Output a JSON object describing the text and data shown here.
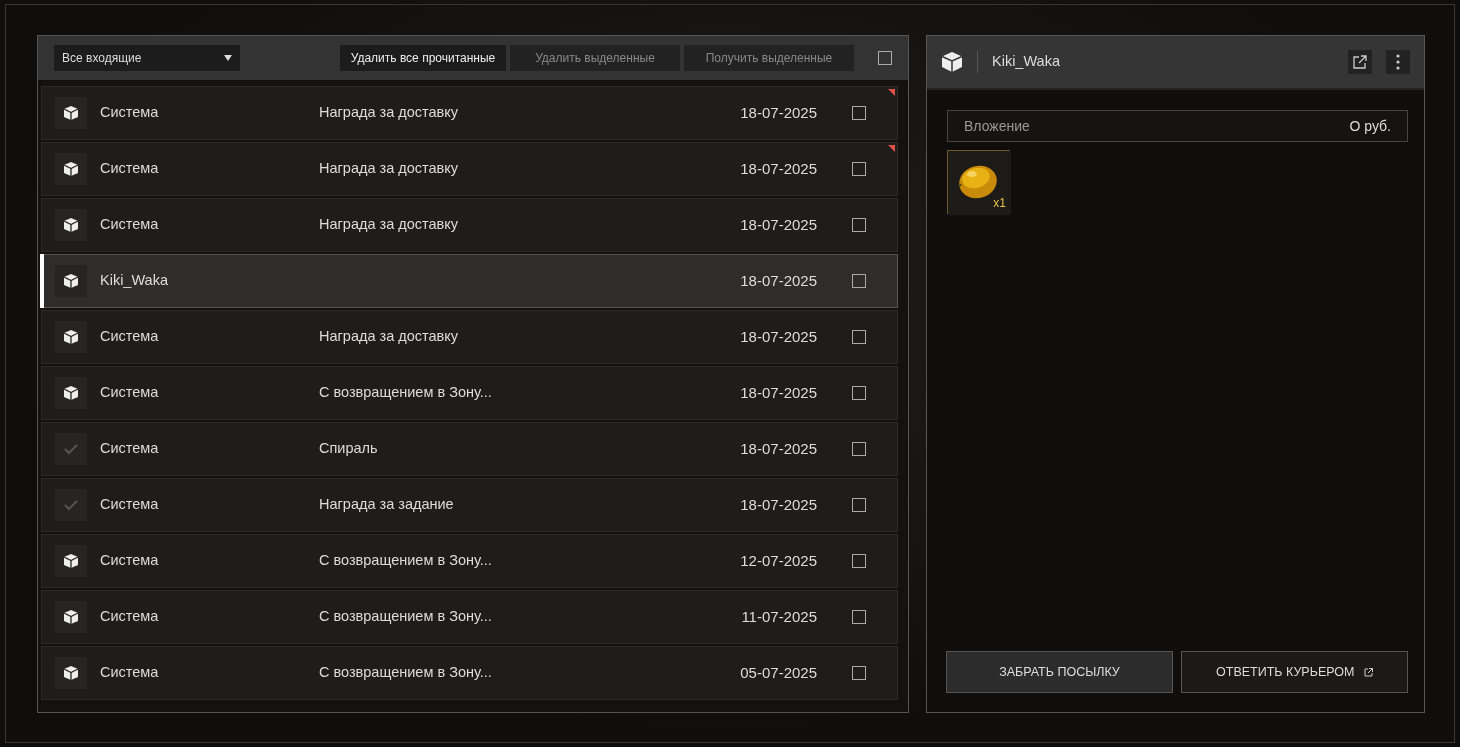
{
  "toolbar": {
    "filter": "Все входящие",
    "buttons": [
      {
        "label": "Удалить все прочитанные",
        "disabled": false
      },
      {
        "label": "Удалить выделенные",
        "disabled": true
      },
      {
        "label": "Получить выделенные",
        "disabled": true
      }
    ],
    "select_all": {
      "checked": false
    }
  },
  "messages": [
    {
      "kind": "parcel",
      "sender": "Система",
      "subject": "Награда за доставку",
      "date": "18-07-2025",
      "unread": true,
      "selected": false,
      "checked": false
    },
    {
      "kind": "parcel",
      "sender": "Система",
      "subject": "Награда за доставку",
      "date": "18-07-2025",
      "unread": true,
      "selected": false,
      "checked": false
    },
    {
      "kind": "parcel",
      "sender": "Система",
      "subject": "Награда за доставку",
      "date": "18-07-2025",
      "unread": false,
      "selected": false,
      "checked": false
    },
    {
      "kind": "parcel",
      "sender": "Kiki_Waka",
      "date": "18-07-2025",
      "unread": false,
      "selected": true,
      "checked": false
    },
    {
      "kind": "parcel",
      "sender": "Система",
      "subject": "Награда за доставку",
      "date": "18-07-2025",
      "unread": false,
      "selected": false,
      "checked": false
    },
    {
      "kind": "parcel",
      "sender": "Система",
      "subject": "С возвращением в Зону...",
      "date": "18-07-2025",
      "unread": false,
      "selected": false,
      "checked": false
    },
    {
      "kind": "read",
      "sender": "Система",
      "subject": "Спираль",
      "date": "18-07-2025",
      "unread": false,
      "selected": false,
      "checked": false
    },
    {
      "kind": "read",
      "sender": "Система",
      "subject": "Награда за задание",
      "date": "18-07-2025",
      "unread": false,
      "selected": false,
      "checked": false
    },
    {
      "kind": "parcel",
      "sender": "Система",
      "subject": "С возвращением в Зону...",
      "date": "12-07-2025",
      "unread": false,
      "selected": false,
      "checked": false
    },
    {
      "kind": "parcel",
      "sender": "Система",
      "subject": "С возвращением в Зону...",
      "date": "11-07-2025",
      "unread": false,
      "selected": false,
      "checked": false
    },
    {
      "kind": "parcel",
      "sender": "Система",
      "subject": "С возвращением в Зону...",
      "date": "05-07-2025",
      "unread": false,
      "selected": false,
      "checked": false
    }
  ],
  "detail": {
    "title": "Kiki_Waka",
    "attachment_label": "Вложение",
    "attachment_value": "О руб.",
    "items": [
      {
        "kind": "picture",
        "count": "x1"
      }
    ],
    "buttons": [
      {
        "label": "ЗАБРАТЬ ПОСЫЛКУ",
        "kind": "primary"
      },
      {
        "label": "ОТВЕТИТЬ КУРЬЕРОМ",
        "kind": "external"
      }
    ]
  }
}
